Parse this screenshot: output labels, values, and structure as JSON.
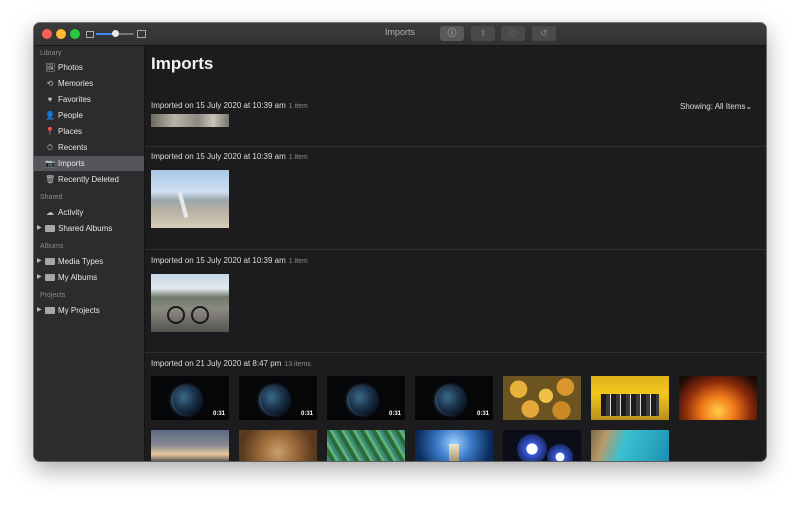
{
  "window": {
    "title": "Imports"
  },
  "toolbar": {
    "info_glyph": "ⓘ",
    "share_glyph": "⇪",
    "favorite_glyph": "♡",
    "rotate_glyph": "↺",
    "zoom_level_fraction": 0.5
  },
  "sidebar": {
    "sections": {
      "library": "Library",
      "shared": "Shared",
      "albums": "Albums",
      "projects": "Projects"
    },
    "items": {
      "photos": "Photos",
      "memories": "Memories",
      "favorites": "Favorites",
      "people": "People",
      "places": "Places",
      "recents": "Recents",
      "imports": "Imports",
      "recently_deleted": "Recently Deleted",
      "activity": "Activity",
      "shared_albums": "Shared Albums",
      "media_types": "Media Types",
      "my_albums": "My Albums",
      "my_projects": "My Projects"
    },
    "selected": "Imports",
    "icons": {
      "photos": "🖼",
      "memories": "⟲",
      "favorites": "♥",
      "people": "👤",
      "places": "📍",
      "recents": "⏱",
      "imports": "📷",
      "recently_deleted": "🗑",
      "activity": "☁"
    }
  },
  "main": {
    "title": "Imports",
    "showing": "Showing: All Items",
    "showing_chevron": "⌄",
    "groups": [
      {
        "heading": "Imported on 15 July 2020 at 10:39 am",
        "count": "1 item"
      },
      {
        "heading": "Imported on 15 July 2020 at 10:39 am",
        "count": "1 item"
      },
      {
        "heading": "Imported on 15 July 2020 at 10:39 am",
        "count": "1 item"
      },
      {
        "heading": "Imported on 21 July 2020 at 8:47 pm",
        "count": "13 items"
      }
    ],
    "video_durations": [
      "0:31",
      "0:31",
      "0:31",
      "0:31"
    ]
  },
  "colors": {
    "accent": "#3d8bfd",
    "selection": "#55555a",
    "window_bg": "#1c1c1e",
    "sidebar_bg": "#2c2c2e"
  }
}
